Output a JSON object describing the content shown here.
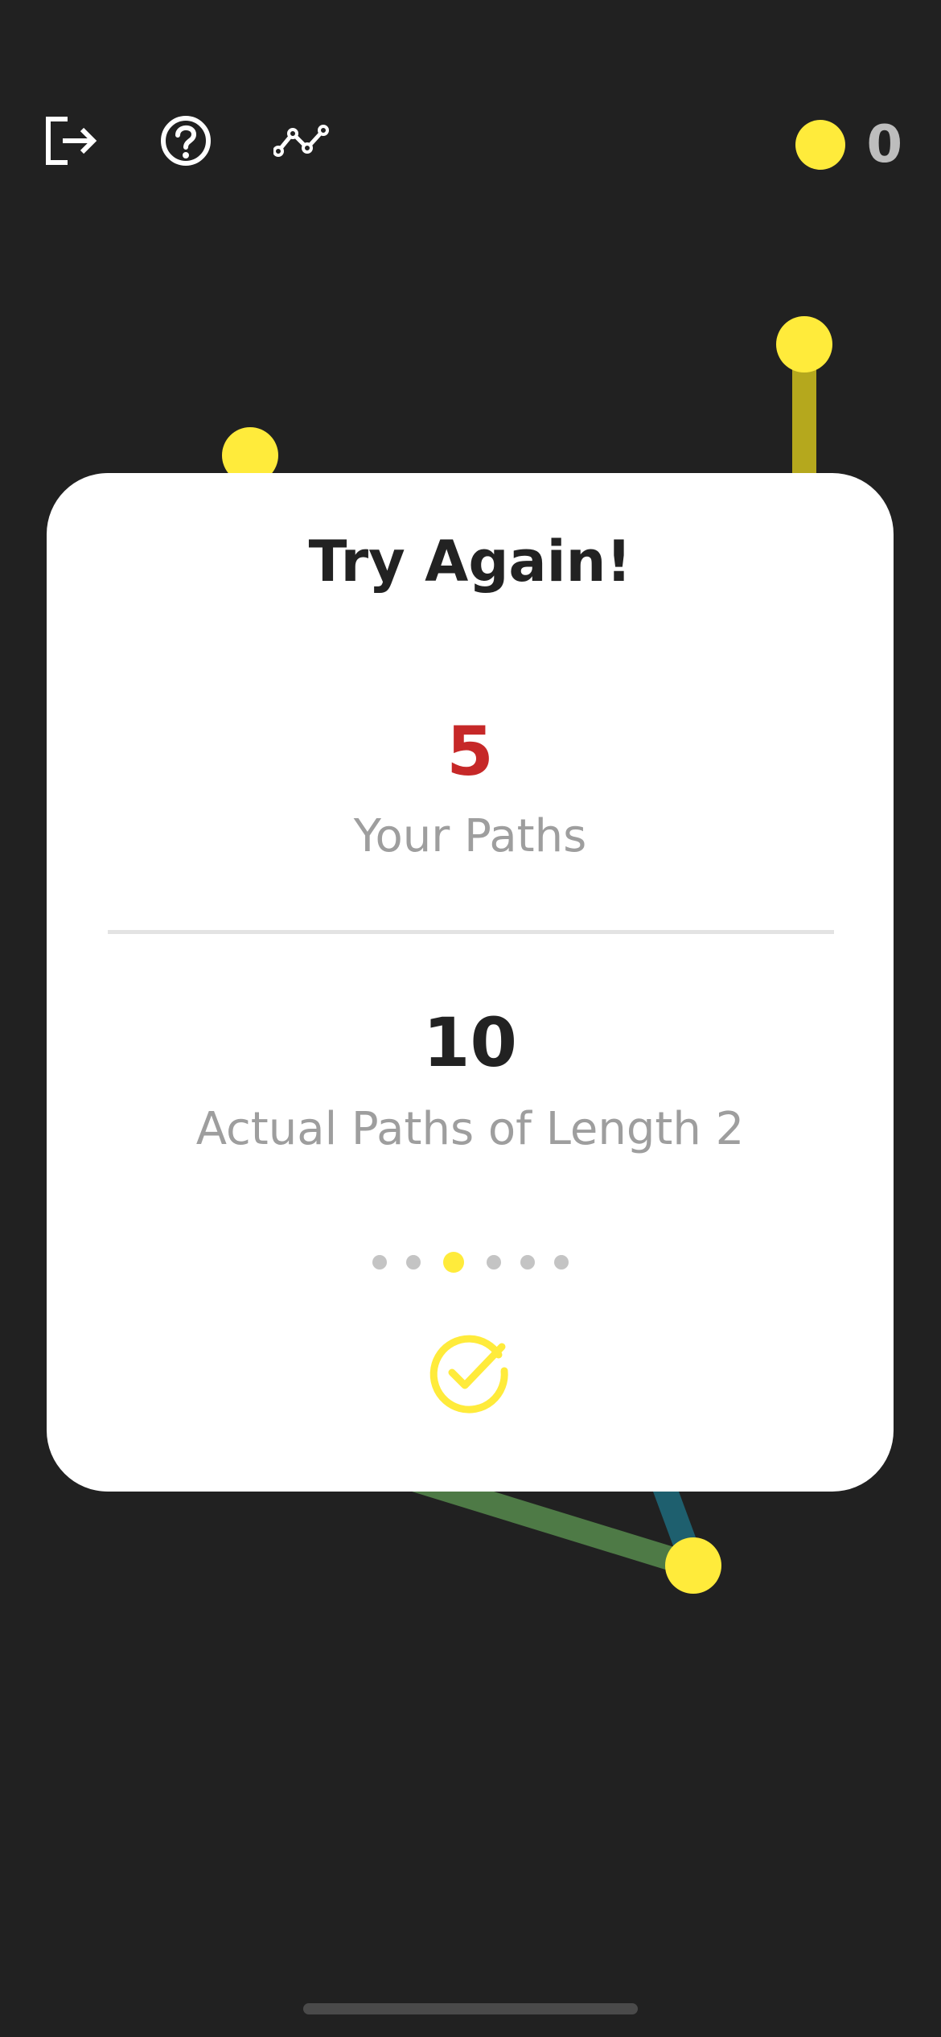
{
  "toolbar": {
    "exit_icon": "exit-icon",
    "help_icon": "help-icon",
    "graph_icon": "graph-icon"
  },
  "coins": {
    "count": "0",
    "icon": "coin-icon"
  },
  "result_card": {
    "title": "Try Again!",
    "your_paths": {
      "value": "5",
      "label": "Your Paths"
    },
    "actual_paths": {
      "value": "10",
      "label": "Actual Paths of Length 2"
    },
    "pager": {
      "total": 6,
      "active_index": 2
    },
    "confirm_icon": "check-circle-icon"
  },
  "colors": {
    "background": "#212121",
    "node": "#ffeb3b",
    "accent": "#ffeb3b",
    "your_paths_number": "#c62828",
    "edge_olive": "#b5a81d",
    "edge_green": "#4e7a46",
    "edge_teal": "#1e5f6e"
  }
}
